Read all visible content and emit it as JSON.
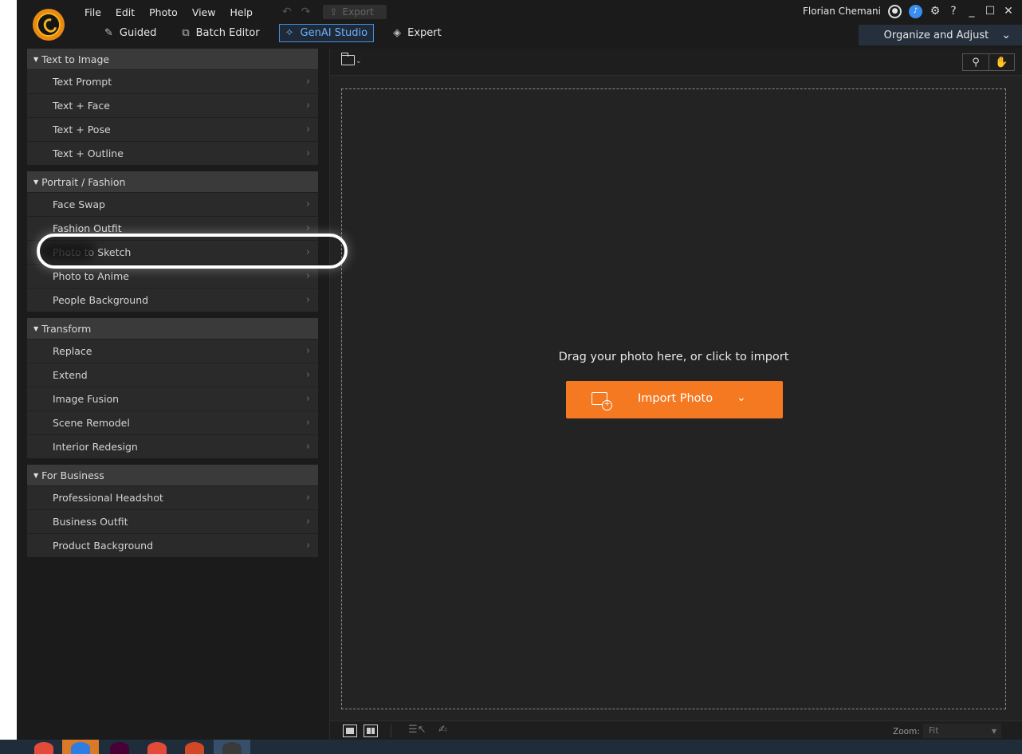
{
  "menu": [
    "File",
    "Edit",
    "Photo",
    "View",
    "Help"
  ],
  "export_label": "Export",
  "mode_tabs": [
    {
      "label": "Guided",
      "icon": "magic-wand-icon"
    },
    {
      "label": "Batch Editor",
      "icon": "batch-icon"
    },
    {
      "label": "GenAI Studio",
      "icon": "sparkle-icon",
      "active": true
    },
    {
      "label": "Expert",
      "icon": "layers-icon"
    }
  ],
  "user": {
    "name": "Florian Chemani"
  },
  "organize_label": "Organize and Adjust",
  "groups": [
    {
      "title": "Text to Image",
      "items": [
        "Text Prompt",
        "Text + Face",
        "Text + Pose",
        "Text + Outline"
      ]
    },
    {
      "title": "Portrait / Fashion",
      "items": [
        "Face Swap",
        "Fashion Outfit",
        "Photo to Sketch",
        "Photo to Anime",
        "People Background"
      ]
    },
    {
      "title": "Transform",
      "items": [
        "Replace",
        "Extend",
        "Image Fusion",
        "Scene Remodel",
        "Interior Redesign"
      ]
    },
    {
      "title": "For Business",
      "items": [
        "Professional Headshot",
        "Business Outfit",
        "Product Background"
      ]
    }
  ],
  "workspace": {
    "drop_text": "Drag your photo here, or click to import",
    "import_label": "Import Photo"
  },
  "zoom": {
    "label": "Zoom:",
    "value": "Fit"
  },
  "colors": {
    "accent": "#f47920",
    "active_tab": "#3f8fe0",
    "background": "#1b1b1b"
  }
}
